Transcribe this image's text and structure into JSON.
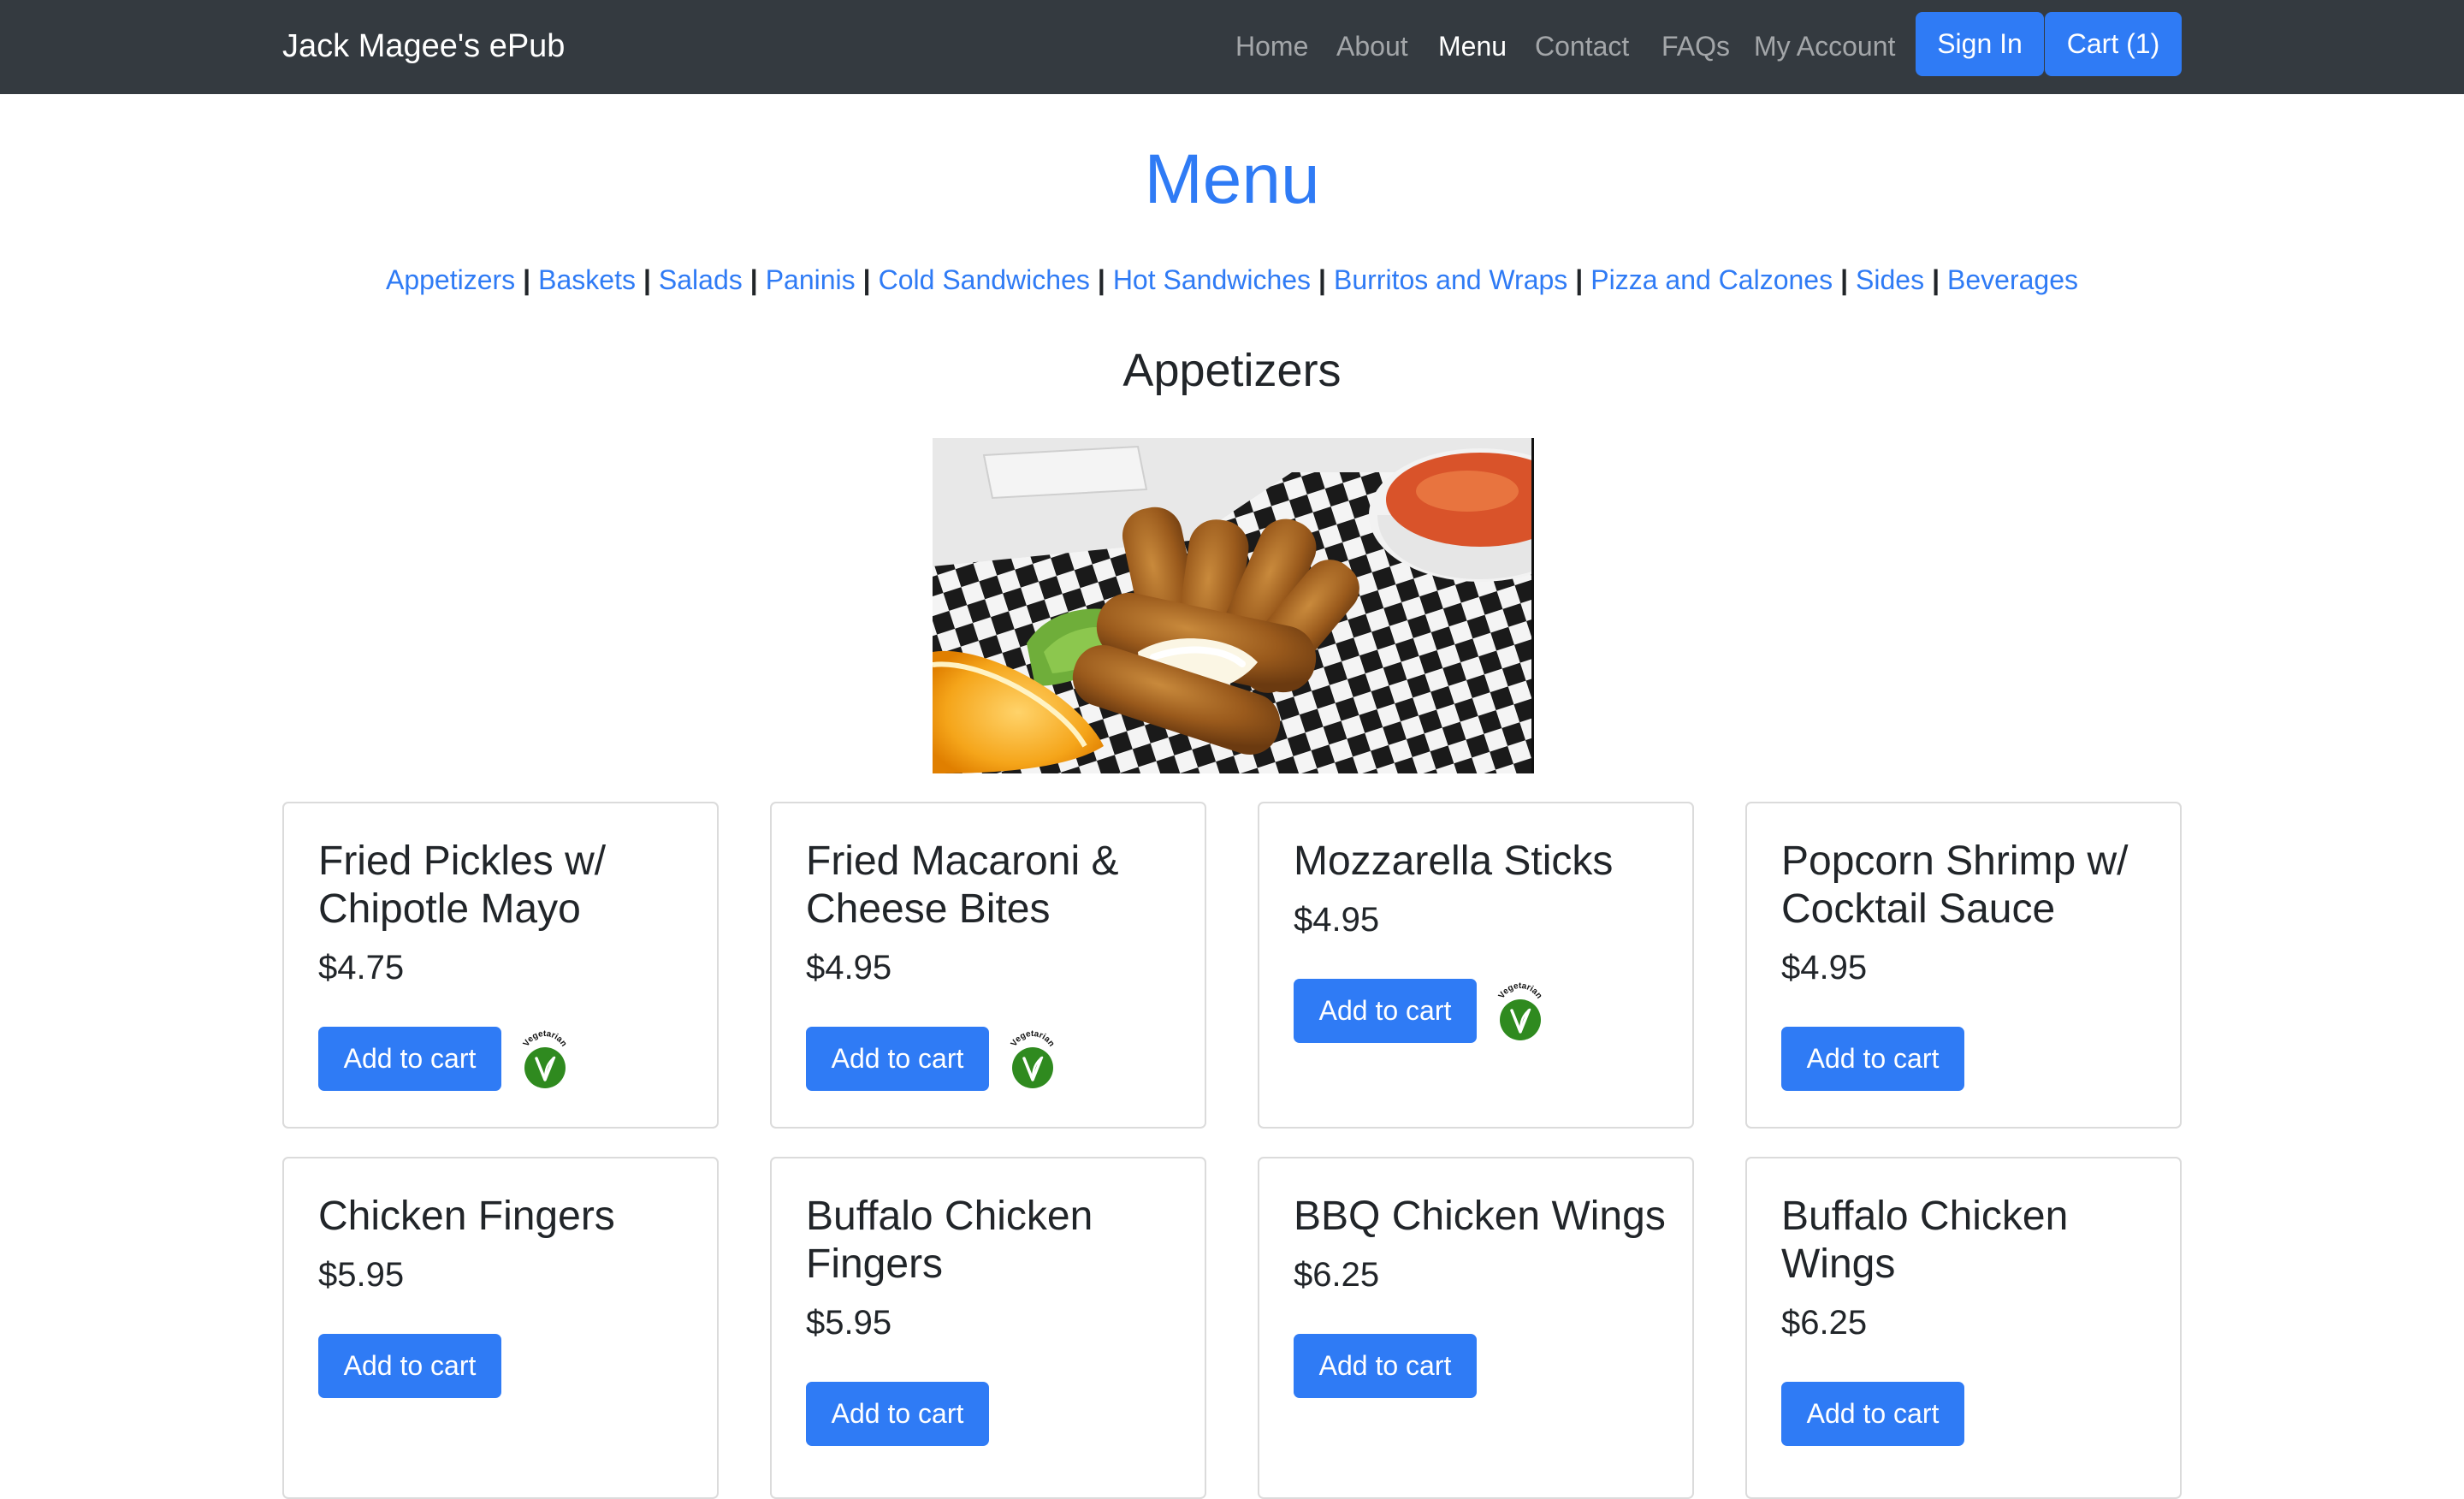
{
  "nav": {
    "brand": "Jack Magee's ePub",
    "links": [
      "Home",
      "About",
      "Menu",
      "Contact",
      "FAQs",
      "My Account"
    ],
    "active": "Menu",
    "sign_in": "Sign In",
    "cart": "Cart (1)"
  },
  "page": {
    "title": "Menu",
    "section_title": "Appetizers"
  },
  "categories": [
    "Appetizers",
    "Baskets",
    "Salads",
    "Paninis",
    "Cold Sandwiches",
    "Hot Sandwiches",
    "Burritos and Wraps",
    "Pizza and Calzones",
    "Sides",
    "Beverages"
  ],
  "category_separator": "|",
  "badge_label": "Vegetarian",
  "add_to_cart_label": "Add to cart",
  "items": [
    {
      "name": "Fried Pickles w/ Chipotle Mayo",
      "price": "$4.75",
      "vegetarian": true
    },
    {
      "name": "Fried Macaroni & Cheese Bites",
      "price": "$4.95",
      "vegetarian": true
    },
    {
      "name": "Mozzarella Sticks",
      "price": "$4.95",
      "vegetarian": true
    },
    {
      "name": "Popcorn Shrimp w/ Cocktail Sauce",
      "price": "$4.95",
      "vegetarian": false
    },
    {
      "name": "Chicken Fingers",
      "price": "$5.95",
      "vegetarian": false
    },
    {
      "name": "Buffalo Chicken Fingers",
      "price": "$5.95",
      "vegetarian": false
    },
    {
      "name": "BBQ Chicken Wings",
      "price": "$6.25",
      "vegetarian": false
    },
    {
      "name": "Buffalo Chicken Wings",
      "price": "$6.25",
      "vegetarian": false
    }
  ],
  "colors": {
    "navbar": "#343a40",
    "primary": "#2f7bf5",
    "badge_green": "#2f8a1f"
  }
}
